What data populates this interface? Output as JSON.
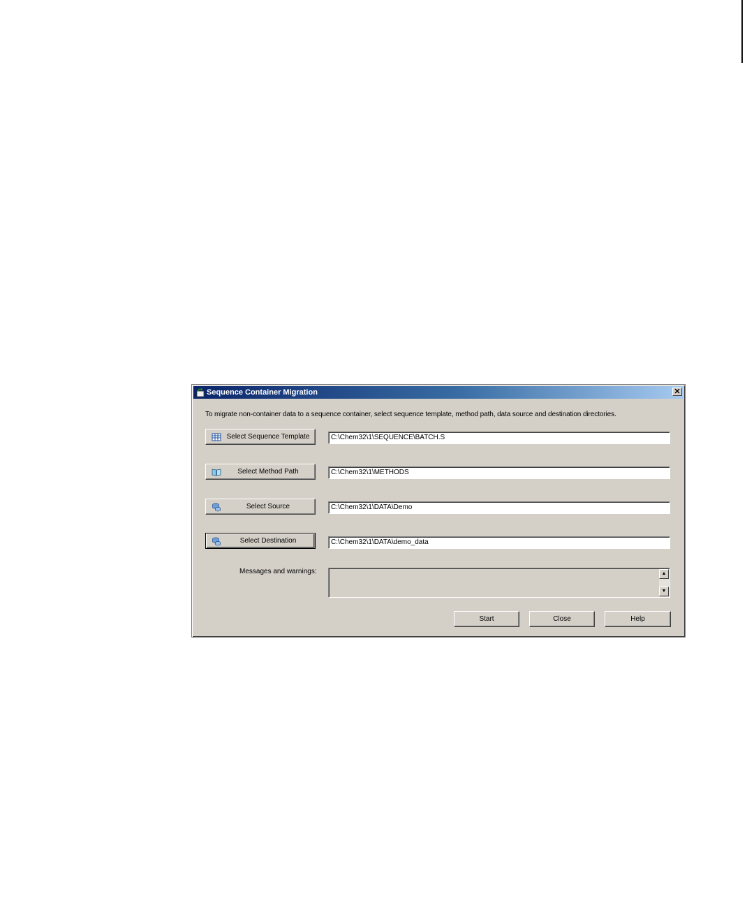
{
  "window": {
    "title": "Sequence Container Migration",
    "close_glyph": "✕"
  },
  "instructions": "To migrate non-container data to a sequence container, select sequence template, method path, data source and destination directories.",
  "rows": [
    {
      "button_label": "Select Sequence Template",
      "icon": "sequence-table-icon",
      "value": "C:\\Chem32\\1\\SEQUENCE\\BATCH.S"
    },
    {
      "button_label": "Select Method Path",
      "icon": "method-book-icon",
      "value": "C:\\Chem32\\1\\METHODS"
    },
    {
      "button_label": "Select Source",
      "icon": "database-icon",
      "value": "C:\\Chem32\\1\\DATA\\Demo"
    },
    {
      "button_label": "Select Destination",
      "icon": "database-icon",
      "value": "C:\\Chem32\\1\\DATA\\demo_data"
    }
  ],
  "messages": {
    "label": "Messages and warnings:",
    "value": ""
  },
  "actions": {
    "start_label": "Start",
    "close_label": "Close",
    "help_label": "Help"
  },
  "colors": {
    "dialog_bg": "#d4d0c8",
    "titlebar_start": "#0a246a",
    "titlebar_end": "#a6caf0"
  }
}
